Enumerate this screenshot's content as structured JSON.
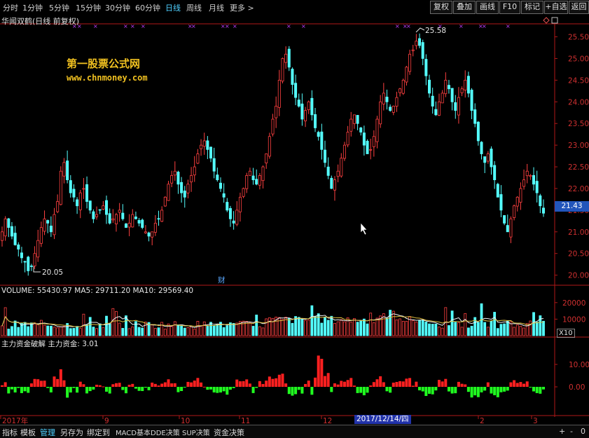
{
  "toolbar": {
    "periods": [
      "分时",
      "1分钟",
      "5分钟",
      "15分钟",
      "30分钟",
      "60分钟",
      "日线",
      "周线",
      "月线",
      "更多 >"
    ],
    "active_period": "日线",
    "buttons": [
      "复权",
      "叠加",
      "画线",
      "F10",
      "标记",
      "+自选",
      "返回"
    ]
  },
  "stock": {
    "title": "华闻双鹤(日线 前复权)"
  },
  "watermark": {
    "line1": "第一股票公式网",
    "line2": "www.chnmoney.com"
  },
  "price_panel": {
    "max_label": "25.58",
    "min_label": "20.05",
    "current_price": "21.43",
    "event_marker": "财",
    "ticks": [
      "25.50",
      "25.00",
      "24.50",
      "24.00",
      "23.50",
      "23.00",
      "22.50",
      "22.00",
      "21.50",
      "21.00",
      "20.50",
      "20.00"
    ]
  },
  "volume_panel": {
    "header": "VOLUME: 55430.97  MA5: 29711.20  MA10: 29569.40",
    "ticks": [
      "20000",
      "10000"
    ],
    "unit": "X10"
  },
  "fund_panel": {
    "header": "主力资金破解  主力资金: 3.01",
    "ticks": [
      "10.00",
      "0.00"
    ]
  },
  "x_axis": {
    "labels": [
      "2017年",
      "9",
      "10",
      "11",
      "12",
      "1",
      "2",
      "3"
    ],
    "cursor_date": "2017/12/14/四"
  },
  "bottom_tabs": [
    "指标",
    "模板",
    "管理",
    "另存为",
    "绑定到",
    "MACD基本",
    "DDE决策",
    "SUP决策",
    "资金决策"
  ],
  "active_tab": "管理",
  "bottom_right": [
    "+",
    "-",
    "0"
  ],
  "colors": {
    "up": "#ff4040",
    "down": "#54ffff",
    "ma_volume": "#e0e0e0",
    "axis": "#c02020",
    "fund_up": "#ff2020",
    "fund_down": "#20ff20"
  },
  "chart_data": [
    {
      "type": "candlestick",
      "title": "华闻双鹤(日线 前复权)",
      "x_range": [
        "2017-08",
        "2018-03"
      ],
      "y_range": [
        19.8,
        25.8
      ],
      "annotations": {
        "max": 25.58,
        "min": 20.05,
        "last": 21.43
      },
      "close_series": [
        21.0,
        21.3,
        21.1,
        20.9,
        20.7,
        20.6,
        20.4,
        20.3,
        20.1,
        20.2,
        20.5,
        20.8,
        21.1,
        21.3,
        21.2,
        21.0,
        21.4,
        21.7,
        22.4,
        22.6,
        22.2,
        21.9,
        21.8,
        21.6,
        21.9,
        22.0,
        21.7,
        21.5,
        21.3,
        21.4,
        21.5,
        21.6,
        21.4,
        21.2,
        21.3,
        21.4,
        21.5,
        21.3,
        21.1,
        21.2,
        21.4,
        21.3,
        21.2,
        21.1,
        21.0,
        20.9,
        21.0,
        21.2,
        21.3,
        21.5,
        21.8,
        22.1,
        22.3,
        22.4,
        22.1,
        21.9,
        21.8,
        22.1,
        22.3,
        22.5,
        22.8,
        23.0,
        23.1,
        22.9,
        22.7,
        22.4,
        22.2,
        22.0,
        21.8,
        21.5,
        21.3,
        21.2,
        21.5,
        21.8,
        22.0,
        22.3,
        22.4,
        22.2,
        22.1,
        22.3,
        22.5,
        22.8,
        23.2,
        23.6,
        23.9,
        24.5,
        25.0,
        25.1,
        24.8,
        24.4,
        24.1,
        23.9,
        23.6,
        23.8,
        24.0,
        23.7,
        23.4,
        23.2,
        22.9,
        22.6,
        22.3,
        22.0,
        22.2,
        22.4,
        22.7,
        23.0,
        23.3,
        23.6,
        23.7,
        23.5,
        23.3,
        23.0,
        22.8,
        22.9,
        23.2,
        23.6,
        24.0,
        24.2,
        24.0,
        23.8,
        23.9,
        24.1,
        24.3,
        24.5,
        24.8,
        25.1,
        25.2,
        25.4,
        25.3,
        25.0,
        24.6,
        24.2,
        23.9,
        23.7,
        24.0,
        24.2,
        24.5,
        24.3,
        24.0,
        23.8,
        24.1,
        24.3,
        24.5,
        24.2,
        23.8,
        23.5,
        23.1,
        22.8,
        22.6,
        22.8,
        22.5,
        22.2,
        21.8,
        21.5,
        21.2,
        21.0,
        21.3,
        21.6,
        21.8,
        22.0,
        22.2,
        22.4,
        22.3,
        22.1,
        21.9,
        21.6,
        21.43
      ]
    },
    {
      "type": "bar",
      "title": "VOLUME",
      "series": [
        {
          "name": "VOLUME",
          "last": 55430.97
        },
        {
          "name": "MA5",
          "last": 29711.2
        },
        {
          "name": "MA10",
          "last": 29569.4
        }
      ],
      "y_ticks": [
        10000,
        20000
      ]
    },
    {
      "type": "bar",
      "title": "主力资金破解",
      "series": [
        {
          "name": "主力资金",
          "last": 3.01
        }
      ],
      "y_ticks": [
        0.0,
        10.0
      ]
    }
  ]
}
